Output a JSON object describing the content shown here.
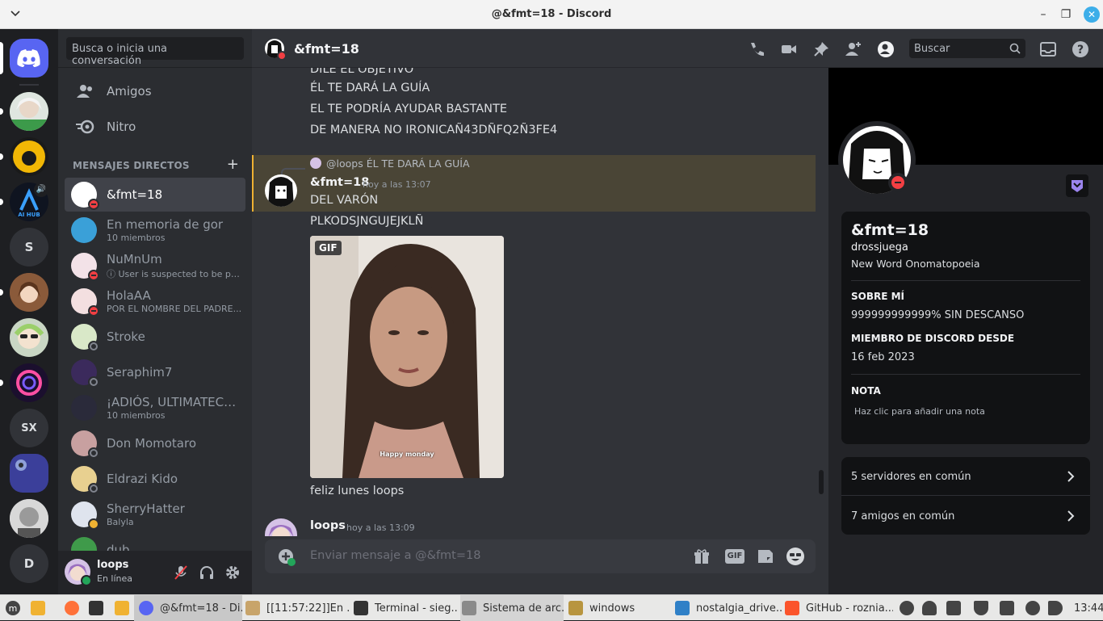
{
  "window": {
    "title": "@&fmt=18 - Discord"
  },
  "search": {
    "placeholder": "Busca o inicia una conversación"
  },
  "nav": {
    "friends": "Amigos",
    "nitro": "Nitro"
  },
  "dm_header": "MENSAJES DIRECTOS",
  "dms": [
    {
      "name": "&fmt=18",
      "sub": "",
      "status": "dnd"
    },
    {
      "name": "En memoria de gor",
      "sub": "10 miembros",
      "status": ""
    },
    {
      "name": "NuMnUm",
      "sub": "ⓘ User is suspected to be par...",
      "status": "dnd"
    },
    {
      "name": "HolaAA",
      "sub": "POR EL NOMBRE DEL PADRE...",
      "status": "dnd"
    },
    {
      "name": "Stroke",
      "sub": "",
      "status": "offline"
    },
    {
      "name": "Seraphim7",
      "sub": "",
      "status": "offline"
    },
    {
      "name": "¡ADIÓS, ULTIMATECR...",
      "sub": "10 miembros",
      "status": ""
    },
    {
      "name": "Don Momotaro",
      "sub": "",
      "status": "offline"
    },
    {
      "name": "Eldrazi Kido",
      "sub": "",
      "status": "offline"
    },
    {
      "name": "SherryHatter",
      "sub": "Balyla",
      "status": "idle"
    },
    {
      "name": "dub",
      "sub": "",
      "status": ""
    }
  ],
  "servers": [
    "S",
    "SX",
    "D"
  ],
  "user": {
    "name": "loops",
    "status": "En línea"
  },
  "channel": {
    "name": "&fmt=18",
    "search_placeholder": "Buscar"
  },
  "messages": {
    "top_lines": [
      "DILE EL OBJETIVO",
      "ÉL TE DARÁ LA GUÍA",
      "EL TE PODRÍA AYUDAR BASTANTE",
      "DE MANERA NO IRONICAÑ43DÑFQ2Ñ3FE4"
    ],
    "reply_ref": "@loops ÉL TE DARÁ LA GUÍA",
    "author": "&fmt=18",
    "time": "hoy a las 13:07",
    "lines": [
      "DEL VARÓN",
      "PLKODSJNGUJEJKLÑ"
    ],
    "gif_badge": "GIF",
    "gif_caption": "Happy monday",
    "after_gif": "feliz lunes loops",
    "next_author": "loops",
    "next_time": "hoy a las 13:09"
  },
  "composer": {
    "placeholder": "Enviar mensaje a @&fmt=18",
    "gif": "GIF"
  },
  "profile": {
    "display_name": "&fmt=18",
    "username": "drossjuega",
    "pronouns": "New Word Onomatopoeia",
    "about_title": "SOBRE MÍ",
    "about": "999999999999% SIN DESCANSO",
    "member_title": "MIEMBRO DE DISCORD DESDE",
    "member_since": "16 feb 2023",
    "note_title": "NOTA",
    "note_placeholder": "Haz clic para añadir una nota",
    "mutual_servers": "5 servidores en común",
    "mutual_friends": "7 amigos en común"
  },
  "taskbar": {
    "items": [
      "@&fmt=18 - Di...",
      "[[11:57:22]]En ...",
      "Terminal - sieg...",
      "Sistema de arc...",
      "windows",
      "nostalgia_drive...",
      "GitHub - roznia..."
    ],
    "clock": "13:44"
  },
  "colors": {
    "blurple": "#5865f2",
    "dnd": "#f23f43",
    "online": "#23a55a",
    "idle": "#f0b232"
  }
}
